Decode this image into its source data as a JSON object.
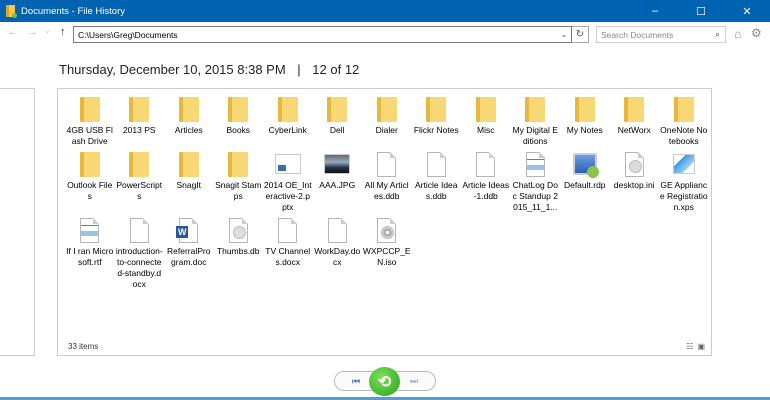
{
  "window": {
    "title": "Documents - File History",
    "minimize": "–",
    "maximize": "☐",
    "close": "✕"
  },
  "toolbar": {
    "back": "←",
    "forward": "→",
    "recent": "⌄",
    "up": "↑",
    "address": "C:\\Users\\Greg\\Documents",
    "search_placeholder": "Search Documents",
    "dropdown": "⌄",
    "refresh": "↻",
    "search_icon": "⌕",
    "home_icon": "⌂",
    "settings_icon": "⚙"
  },
  "header": {
    "date": "Thursday, December 10, 2015 8:38 PM",
    "separator": "|",
    "version": "12 of 12"
  },
  "files": [
    {
      "name": "4GB USB Flash Drive",
      "icon": "folder"
    },
    {
      "name": "2013 PS",
      "icon": "folder"
    },
    {
      "name": "Articles",
      "icon": "folder"
    },
    {
      "name": "Books",
      "icon": "folder"
    },
    {
      "name": "CyberLink",
      "icon": "folder"
    },
    {
      "name": "Dell",
      "icon": "folder"
    },
    {
      "name": "Dialer",
      "icon": "folder"
    },
    {
      "name": "Flickr Notes",
      "icon": "folder"
    },
    {
      "name": "Misc",
      "icon": "folder"
    },
    {
      "name": "My Digital Editions",
      "icon": "folder"
    },
    {
      "name": "My Notes",
      "icon": "folder"
    },
    {
      "name": "NetWorx",
      "icon": "folder"
    },
    {
      "name": "OneNote Notebooks",
      "icon": "folder"
    },
    {
      "name": "Outlook Files",
      "icon": "folder"
    },
    {
      "name": "PowerScripts",
      "icon": "folder"
    },
    {
      "name": "SnagIt",
      "icon": "folder"
    },
    {
      "name": "Snagit Stamps",
      "icon": "folder"
    },
    {
      "name": "2014 OE_Interactive-2.pptx",
      "icon": "pptx"
    },
    {
      "name": "AAA.JPG",
      "icon": "jpg"
    },
    {
      "name": "All My Articles.ddb",
      "icon": "doc"
    },
    {
      "name": "Article Ideas.ddb",
      "icon": "doc"
    },
    {
      "name": "Article Ideas-1.ddb",
      "icon": "doc"
    },
    {
      "name": "ChatLog Doc Standup 2015_11_1...",
      "icon": "rtf"
    },
    {
      "name": "Default.rdp",
      "icon": "rdp"
    },
    {
      "name": "desktop.ini",
      "icon": "ini"
    },
    {
      "name": "GE Appliance Registration.xps",
      "icon": "xps"
    },
    {
      "name": "If I ran Microsoft.rtf",
      "icon": "rtf"
    },
    {
      "name": "introduction-to-connected-standby.docx",
      "icon": "doc"
    },
    {
      "name": "ReferralProgram.doc",
      "icon": "word"
    },
    {
      "name": "Thumbs.db",
      "icon": "ini"
    },
    {
      "name": "TV Channels.docx",
      "icon": "doc"
    },
    {
      "name": "WorkDay.docx",
      "icon": "doc"
    },
    {
      "name": "WXPCCP_EN.iso",
      "icon": "iso"
    }
  ],
  "status": {
    "count": "33 items",
    "details_view": "☷",
    "large_icons_view": "▣"
  },
  "controls": {
    "previous": "⏮",
    "restore": "⟲",
    "next": "⏭"
  }
}
